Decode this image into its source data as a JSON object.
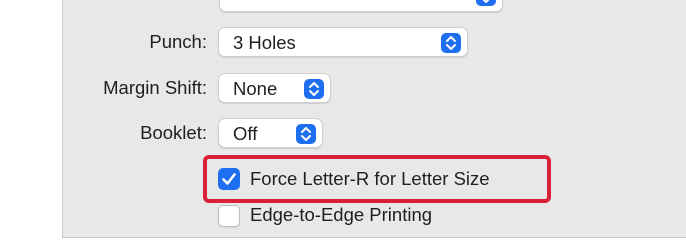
{
  "print_options": {
    "punch": {
      "label": "Punch:",
      "value": "3 Holes"
    },
    "margin_shift": {
      "label": "Margin Shift:",
      "value": "None"
    },
    "booklet": {
      "label": "Booklet:",
      "value": "Off"
    },
    "force_letter_r": {
      "label": "Force Letter-R for Letter Size",
      "checked": true
    },
    "edge_to_edge": {
      "label": "Edge-to-Edge Printing",
      "checked": false
    }
  },
  "colors": {
    "accent": "#1e6ff0",
    "highlight_border": "#d9203a",
    "panel_background": "#e8e8e8"
  }
}
